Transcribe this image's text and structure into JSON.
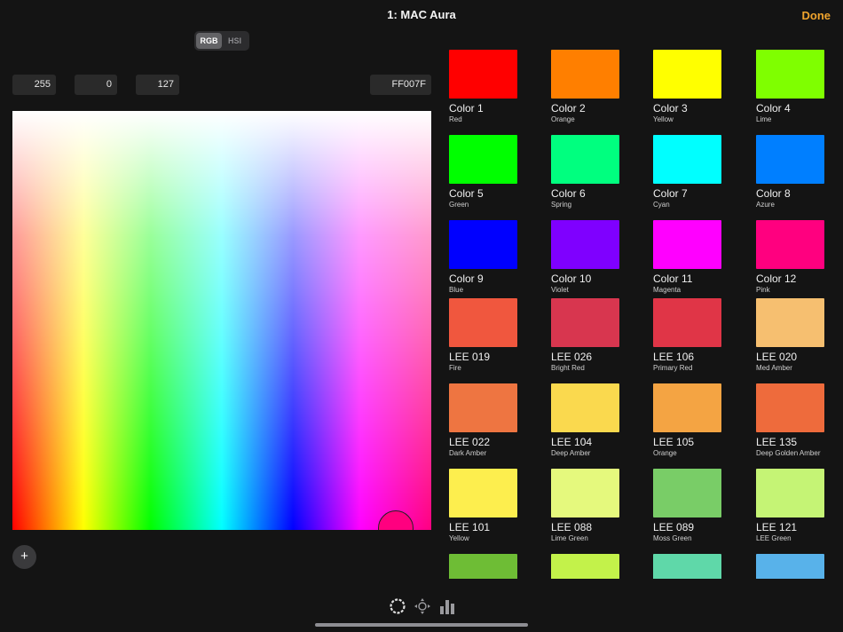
{
  "header": {
    "title": "1: MAC Aura",
    "done_label": "Done"
  },
  "mode": {
    "options": [
      "RGB",
      "HSI"
    ],
    "selected": "RGB"
  },
  "values": {
    "r": "255",
    "g": "0",
    "b": "127",
    "hex": "FF007F"
  },
  "picker": {
    "selected_color": "#ff007f"
  },
  "add_button": {
    "label": "+"
  },
  "swatches": [
    {
      "name": "Color 1",
      "sub": "Red",
      "color": "#ff0000"
    },
    {
      "name": "Color 2",
      "sub": "Orange",
      "color": "#ff7f00"
    },
    {
      "name": "Color 3",
      "sub": "Yellow",
      "color": "#ffff00"
    },
    {
      "name": "Color 4",
      "sub": "Lime",
      "color": "#7fff00"
    },
    {
      "name": "Color 5",
      "sub": "Green",
      "color": "#00ff00"
    },
    {
      "name": "Color 6",
      "sub": "Spring",
      "color": "#00ff7f"
    },
    {
      "name": "Color 7",
      "sub": "Cyan",
      "color": "#00ffff"
    },
    {
      "name": "Color 8",
      "sub": "Azure",
      "color": "#007fff"
    },
    {
      "name": "Color 9",
      "sub": "Blue",
      "color": "#0000ff"
    },
    {
      "name": "Color 10",
      "sub": "Violet",
      "color": "#7f00ff"
    },
    {
      "name": "Color 11",
      "sub": "Magenta",
      "color": "#ff00ff"
    },
    {
      "name": "Color 12",
      "sub": "Pink",
      "color": "#ff007f"
    },
    {
      "name": "LEE 019",
      "sub": "Fire",
      "color": "#f0573e"
    },
    {
      "name": "LEE 026",
      "sub": "Bright Red",
      "color": "#d8364f"
    },
    {
      "name": "LEE 106",
      "sub": "Primary Red",
      "color": "#e03547"
    },
    {
      "name": "LEE 020",
      "sub": "Med Amber",
      "color": "#f6bf70"
    },
    {
      "name": "LEE 022",
      "sub": "Dark Amber",
      "color": "#ee7541"
    },
    {
      "name": "LEE 104",
      "sub": "Deep Amber",
      "color": "#fad94e"
    },
    {
      "name": "LEE 105",
      "sub": "Orange",
      "color": "#f4a443"
    },
    {
      "name": "LEE 135",
      "sub": "Deep Golden Amber",
      "color": "#ee6b3c"
    },
    {
      "name": "LEE 101",
      "sub": "Yellow",
      "color": "#fdee4e"
    },
    {
      "name": "LEE 088",
      "sub": "Lime Green",
      "color": "#e5f97d"
    },
    {
      "name": "LEE 089",
      "sub": "Moss Green",
      "color": "#79cd67"
    },
    {
      "name": "LEE 121",
      "sub": "LEE Green",
      "color": "#c5f475"
    },
    {
      "name": "",
      "sub": "",
      "color": "#6ebd35"
    },
    {
      "name": "",
      "sub": "",
      "color": "#c3f24a"
    },
    {
      "name": "",
      "sub": "",
      "color": "#5fd8a9"
    },
    {
      "name": "",
      "sub": "",
      "color": "#58b2ea"
    }
  ],
  "tabbar": {
    "icons": [
      "color-wheel-icon",
      "position-icon",
      "intensity-bars-icon"
    ]
  },
  "colors": {
    "accent": "#f0a42d",
    "background": "#141414"
  }
}
